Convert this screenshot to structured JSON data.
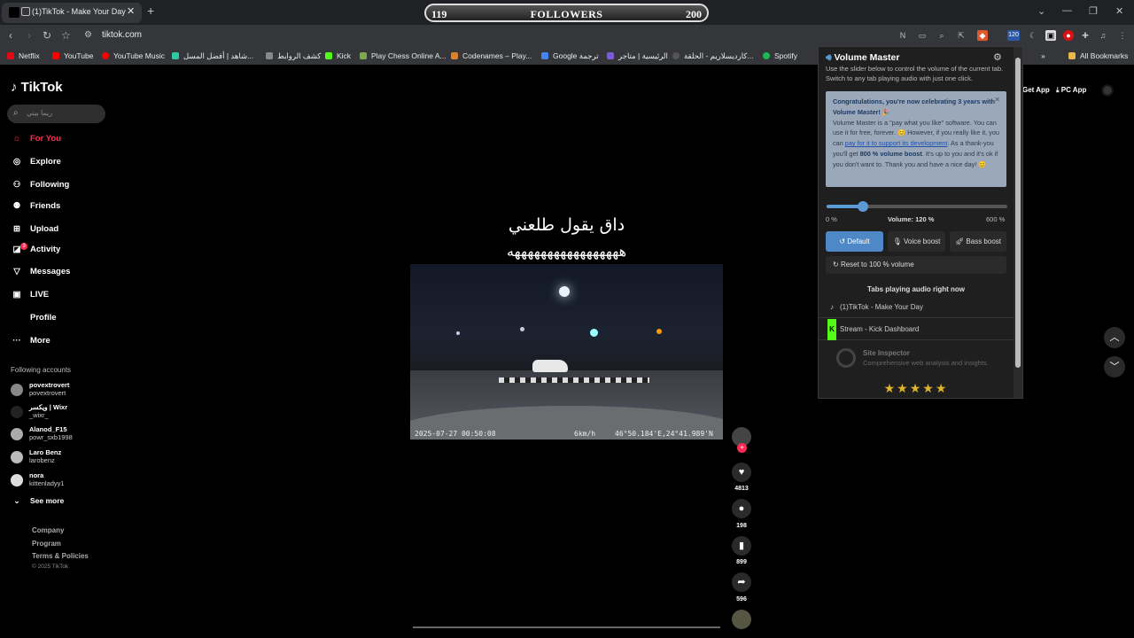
{
  "browser": {
    "tab_title": "(1)TikTok - Make Your Day",
    "new_tab_icon": "+",
    "followers": {
      "left": "119",
      "label": "FOLLOWERS",
      "right": "200"
    },
    "url": "tiktok.com",
    "bookmarks": [
      {
        "label": "Netflix",
        "color": "#e50914"
      },
      {
        "label": "YouTube",
        "color": "#ff0000"
      },
      {
        "label": "YouTube Music",
        "color": "#ff0000"
      },
      {
        "label": "شاهد | أفضل المسل...",
        "color": "#2fc9a4"
      },
      {
        "label": "كشف الروابط",
        "color": "#888888"
      },
      {
        "label": "Kick",
        "color": "#53fc18"
      },
      {
        "label": "Play Chess Online A...",
        "color": "#7fa650"
      },
      {
        "label": "Codenames – Play...",
        "color": "#d9822b"
      },
      {
        "label": "Google ترجمة",
        "color": "#4285f4"
      },
      {
        "label": "الرئيسية | متاجر",
        "color": "#7b5cd6"
      },
      {
        "label": "كارديسلاريم - الحلقة...",
        "color": "#555555"
      },
      {
        "label": "Spotify",
        "color": "#1db954"
      }
    ],
    "all_bookmarks": "All Bookmarks",
    "ext_badge": "120"
  },
  "sidebar": {
    "logo": "TikTok",
    "search_placeholder": "ريما بيني",
    "nav": [
      "For You",
      "Explore",
      "Following",
      "Friends",
      "Upload",
      "Activity",
      "Messages",
      "LIVE",
      "Profile",
      "More"
    ],
    "activity_badge": "3",
    "following_title": "Following accounts",
    "accounts": [
      {
        "name": "povextrovert",
        "handle": "povextrovert"
      },
      {
        "name": "ويكسر | Wixr",
        "handle": "_wixr_"
      },
      {
        "name": "Alanod_F15",
        "handle": "powr_sxb1998"
      },
      {
        "name": "Laro Benz",
        "handle": "larobenz"
      },
      {
        "name": "nora",
        "handle": "kittenladyy1"
      }
    ],
    "see_more": "See more",
    "footer": [
      "Company",
      "Program",
      "Terms & Policies"
    ],
    "copyright": "© 2025 TikTok"
  },
  "topright": {
    "get_app": "Get App",
    "pc_app": "PC App"
  },
  "video": {
    "caption_line1": "داق يقول طلعني",
    "caption_line2": "هههههههههههههههههه",
    "osd_time": "2025-07-27 00:50:08",
    "osd_speed": "6km/h",
    "osd_coord": "46°50.184'E,24°41.989'N",
    "likes": "4813",
    "comments": "198",
    "saves": "899",
    "shares": "596"
  },
  "volume_master": {
    "title": "Volume Master",
    "subtitle": "Use the slider below to control the volume of the current tab. Switch to any tab playing audio with just one click.",
    "promo_title": "Congratulations, you're now celebrating 3 years with Volume Master! 🎉",
    "promo_p1": "Volume Master is a \"pay what you like\" software. You can use it for free, forever. 😊 However, if you really like it, you can",
    "promo_link": "pay for it to support its development",
    "promo_p2": ". As a thank-you you'll get",
    "promo_boost": "800 % volume boost",
    "promo_p3": ". It's up to you and it's ok if you don't want to. Thank you and have a nice day! 😊",
    "min_label": "0 %",
    "volume_label": "Volume: 120 %",
    "max_label": "600 %",
    "volume_fraction": 0.2,
    "buttons": [
      "Default",
      "Voice boost",
      "Bass boost"
    ],
    "reset_label": "Reset to 100 % volume",
    "tabs_header": "Tabs playing audio right now",
    "tabs": [
      "(1)TikTok - Make Your Day",
      "Stream - Kick Dashboard"
    ],
    "inspector_title": "Site Inspector",
    "inspector_desc": "Comprehensive web analysis and insights.",
    "stars": "★★★★★"
  }
}
